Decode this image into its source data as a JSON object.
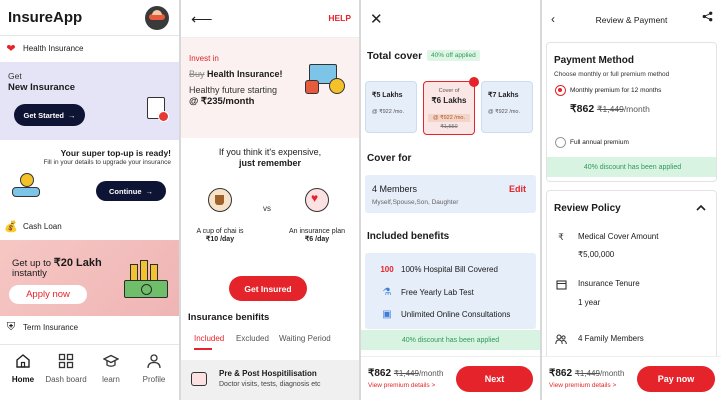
{
  "home": {
    "app_title": "InsureApp",
    "health_section_label": "Health Insurance",
    "health_card": {
      "get": "Get",
      "title": "New Insurance",
      "button": "Get Started"
    },
    "topup": {
      "title": "Your super top-up is ready!",
      "subtitle": "Fill in your details to upgrade your insurance",
      "button": "Continue"
    },
    "loan_section_label": "Cash Loan",
    "loan_card": {
      "prefix": "Get up to ",
      "amount": "₹20 Lakh",
      "line2": "instantly",
      "button": "Apply now"
    },
    "term_section_label": "Term Insurance",
    "nav": [
      {
        "label": "Home",
        "icon": "home-icon"
      },
      {
        "label": "Dash board",
        "icon": "dashboard-icon"
      },
      {
        "label": "learn",
        "icon": "learn-icon"
      },
      {
        "label": "Profile",
        "icon": "profile-icon"
      }
    ]
  },
  "health_page": {
    "help": "HELP",
    "invest_in": "Invest in",
    "buy_strike": "Buy",
    "buy_rest": " Health Insurance!",
    "healthy_future": "Healthy future starting",
    "price": "@ ₹235/month",
    "think": "If you think it's expensive,",
    "remember": "just remember",
    "chai": {
      "line1": "A cup of chai is",
      "line2": "₹10 /day"
    },
    "vs": "vs",
    "plan": {
      "line1": "An insurance plan",
      "line2": "₹6 /day"
    },
    "cta": "Get Insured",
    "benefits_title": "Insurance benifits",
    "tabs": [
      "Included",
      "Excluded",
      "Waiting Period"
    ],
    "item": {
      "title": "Pre & Post Hospitilisation",
      "subtitle": "Doctor visits, tests, diagnosis etc"
    }
  },
  "plan_page": {
    "total_cover": "Total cover",
    "discount_badge": "40% off applied",
    "covers": [
      {
        "amount": "₹5 Lakhs",
        "per": "@ ₹922 /mo."
      },
      {
        "caption": "Cover of",
        "amount": "₹6 Lakhs",
        "per": "@ ₹922 /mo.",
        "old": "₹1,550"
      },
      {
        "amount": "₹7 Lakhs",
        "per": "@ ₹922 /mo."
      }
    ],
    "cover_for": "Cover for",
    "members": "4 Members",
    "members_sub": "Myself,Spouse,Son, Daughter",
    "edit": "Edit",
    "included_benefits": "Included benefits",
    "benefits": [
      "100% Hospital Bill Covered",
      "Free Yearly Lab Test",
      "Unlimited Online Consultations"
    ],
    "discount_note": "40% discount has been applied",
    "price": "₹862",
    "old_price": "₹1,449",
    "per_month": "/month",
    "view_details": "View premium details >",
    "next": "Next"
  },
  "payment_page": {
    "title": "Review & Payment",
    "method_title": "Payment Method",
    "method_sub": "Choose monthly or full premium method",
    "monthly_option": "Monthly premium for 12 months",
    "price": "₹862",
    "old_price": "₹1,449",
    "per_month": "/month",
    "annual_option": "Full annual premium",
    "discount_note": "40% discount has been applied",
    "review_title": "Review Policy",
    "medical_label": "Medical Cover Amount",
    "medical_value": "₹5,00,000",
    "tenure_label": "Insurance Tenure",
    "tenure_value": "1 year",
    "family_label": "4 Family Members",
    "view_details": "View premium details >",
    "pay": "Pay now"
  },
  "colors": {
    "accent": "#e4242a",
    "navy": "#0e1433",
    "success": "#2e9a5a"
  }
}
